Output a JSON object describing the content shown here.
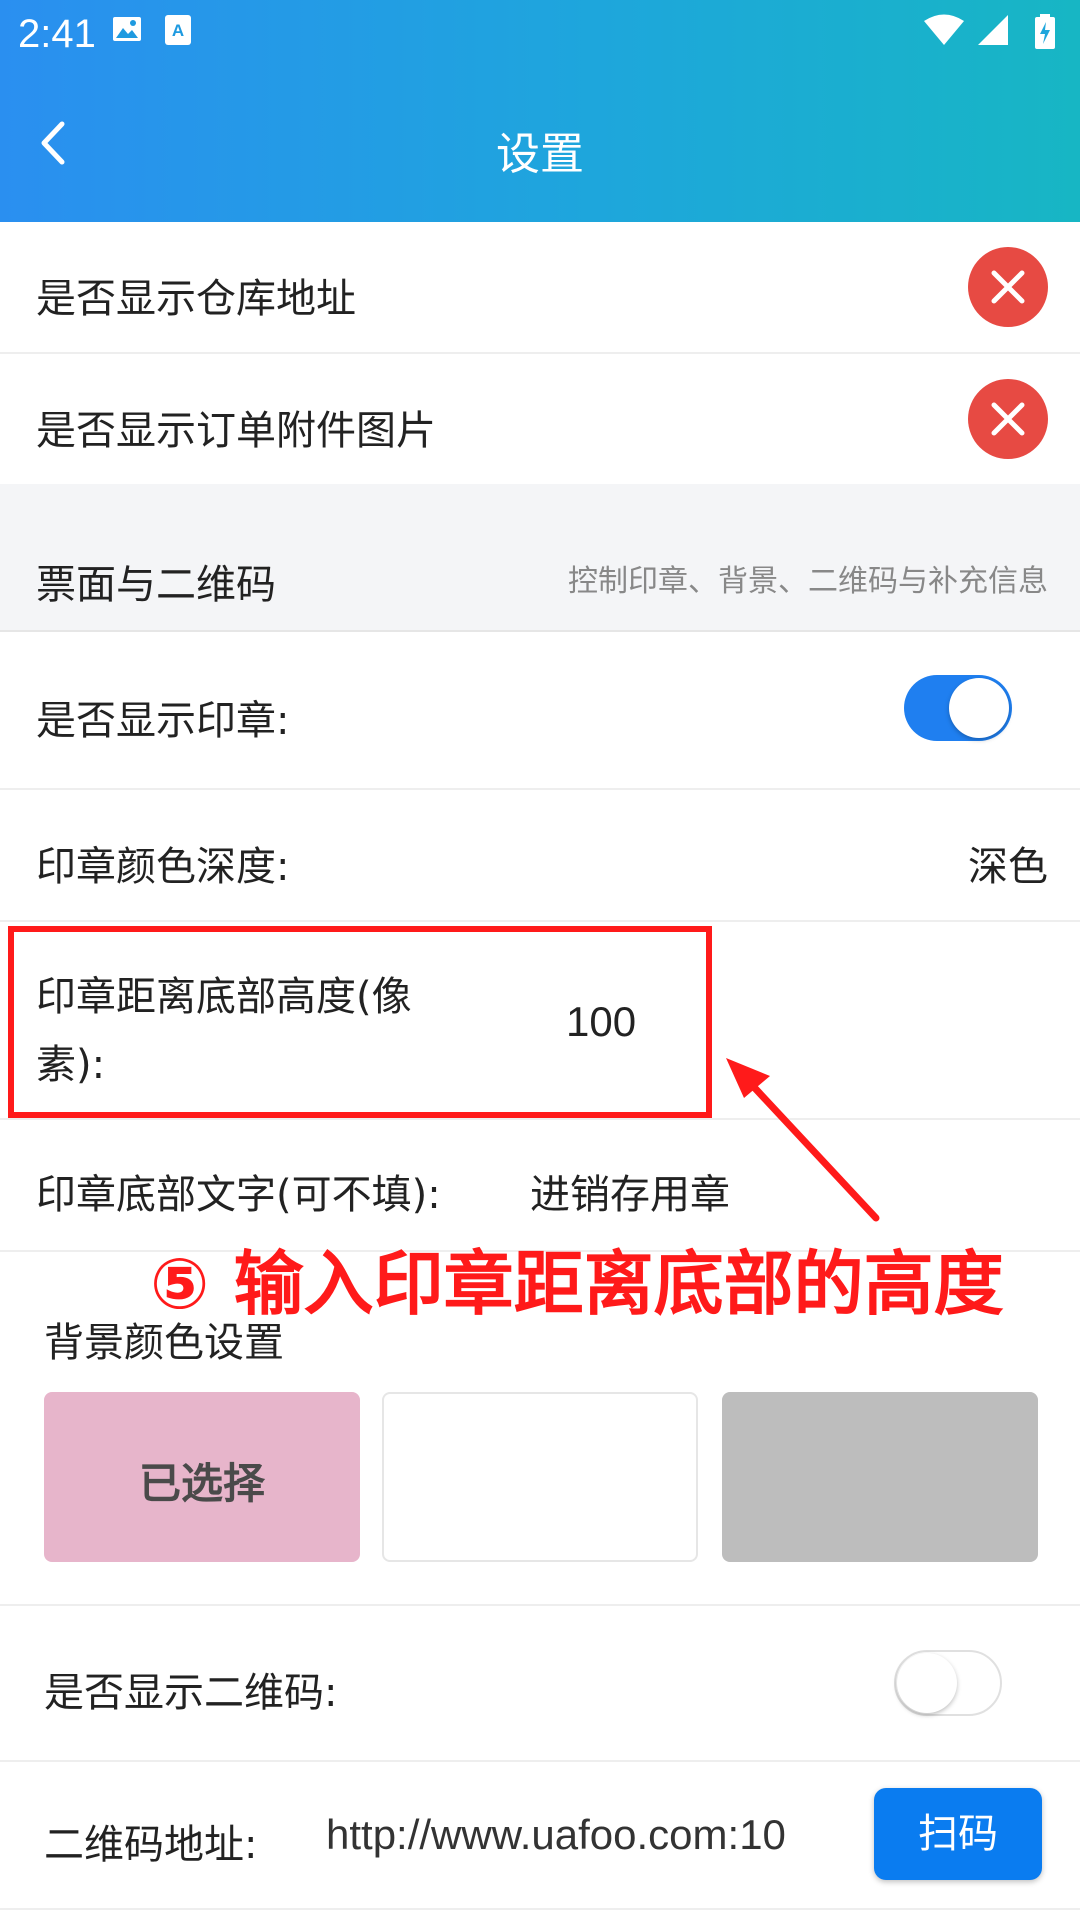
{
  "status_bar": {
    "time": "2:41"
  },
  "header": {
    "title": "设置"
  },
  "rows": {
    "show_warehouse_address": {
      "label": "是否显示仓库地址"
    },
    "show_order_attachments": {
      "label": "是否显示订单附件图片"
    }
  },
  "section": {
    "title": "票面与二维码",
    "description": "控制印章、背景、二维码与补充信息"
  },
  "stamp": {
    "show_label": "是否显示印章:",
    "show_on": true,
    "color_depth_label": "印章颜色深度:",
    "color_depth_value": "深色",
    "bottom_height_label_line1": "印章距离底部高度(像",
    "bottom_height_label_line2": "素):",
    "bottom_height_value": "100",
    "bottom_text_label": "印章底部文字(可不填):",
    "bottom_text_value": "进销存用章"
  },
  "annotation": {
    "text": "⑤ 输入印章距离底部的高度"
  },
  "background": {
    "title": "背景颜色设置",
    "options": [
      {
        "color": "#e7b5cb",
        "text": "已选择"
      },
      {
        "color": "#ffffff",
        "text": ""
      },
      {
        "color": "#bdbdbd",
        "text": ""
      }
    ]
  },
  "qrcode": {
    "show_label": "是否显示二维码:",
    "show_on": false,
    "url_label": "二维码地址:",
    "url_value": "http://www.uafoo.com:10",
    "scan_button": "扫码"
  },
  "colors": {
    "accent": "#1f7ff0",
    "danger": "#e74a43",
    "annotation": "#ff1a1a"
  }
}
